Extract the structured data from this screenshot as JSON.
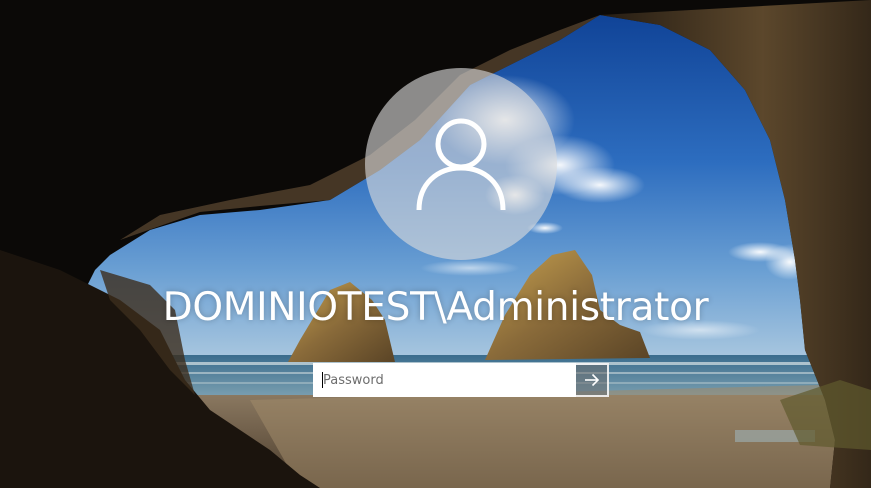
{
  "login": {
    "username": "DOMINIOTEST\\Administrator",
    "password_placeholder": "Password",
    "password_value": ""
  },
  "icons": {
    "avatar": "user-silhouette-icon",
    "submit": "arrow-right-icon"
  },
  "colors": {
    "text": "#ffffff",
    "avatar_circle": "#dcdcdc",
    "input_background": "#ffffff",
    "submit_background": "#6e6e6e"
  }
}
